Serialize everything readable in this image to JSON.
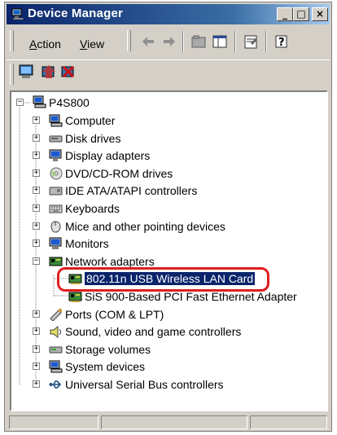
{
  "window": {
    "title": "Device Manager",
    "title_icon": "device-manager-icon"
  },
  "title_buttons": {
    "minimize": "_",
    "maximize": "□",
    "close": "×"
  },
  "menu": {
    "action": {
      "hotkey": "A",
      "rest": "ction"
    },
    "view": {
      "hotkey": "V",
      "rest": "iew"
    }
  },
  "toolbar": {
    "icons": [
      "back-arrow-icon",
      "forward-arrow-icon",
      "up-folder-icon",
      "show-hide-tree-icon",
      "properties-icon",
      "help-icon"
    ]
  },
  "toolbar2": {
    "icons": [
      "scan-hardware-icon",
      "update-driver-icon",
      "uninstall-icon"
    ]
  },
  "tree": {
    "root": "P4S800",
    "items": [
      {
        "label": "Computer",
        "icon": "computer-icon",
        "state": "collapsed"
      },
      {
        "label": "Disk drives",
        "icon": "disk-drive-icon",
        "state": "collapsed"
      },
      {
        "label": "Display adapters",
        "icon": "display-adapter-icon",
        "state": "collapsed"
      },
      {
        "label": "DVD/CD-ROM drives",
        "icon": "dvd-drive-icon",
        "state": "collapsed"
      },
      {
        "label": "IDE ATA/ATAPI controllers",
        "icon": "ide-controller-icon",
        "state": "collapsed"
      },
      {
        "label": "Keyboards",
        "icon": "keyboard-icon",
        "state": "collapsed"
      },
      {
        "label": "Mice and other pointing devices",
        "icon": "mouse-icon",
        "state": "collapsed"
      },
      {
        "label": "Monitors",
        "icon": "monitor-icon",
        "state": "collapsed"
      },
      {
        "label": "Network adapters",
        "icon": "network-adapter-icon",
        "state": "expanded"
      },
      {
        "label": "802.11n USB Wireless LAN Card",
        "icon": "network-card-icon",
        "state": "child-selected"
      },
      {
        "label": "SiS 900-Based PCI Fast Ethernet Adapter",
        "icon": "network-card-icon",
        "state": "child"
      },
      {
        "label": "Ports (COM & LPT)",
        "icon": "port-icon",
        "state": "collapsed"
      },
      {
        "label": "Sound, video and game controllers",
        "icon": "sound-icon",
        "state": "collapsed"
      },
      {
        "label": "Storage volumes",
        "icon": "storage-volume-icon",
        "state": "collapsed"
      },
      {
        "label": "System devices",
        "icon": "system-device-icon",
        "state": "collapsed"
      },
      {
        "label": "Universal Serial Bus controllers",
        "icon": "usb-icon",
        "state": "collapsed"
      }
    ]
  },
  "colors": {
    "selection": "#0a246a",
    "highlight_ring": "#e01e1e",
    "title_start": "#0a246a",
    "title_end": "#a6caf0"
  }
}
